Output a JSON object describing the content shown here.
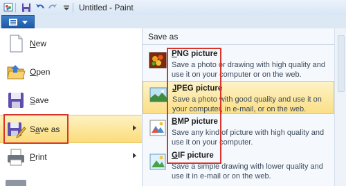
{
  "window": {
    "title": "Untitled - Paint"
  },
  "left_menu": {
    "items": [
      {
        "label": "New",
        "accel": "N",
        "icon": "new-document-icon"
      },
      {
        "label": "Open",
        "accel": "O",
        "icon": "open-folder-icon"
      },
      {
        "label": "Save",
        "accel": "S",
        "icon": "save-disk-icon"
      },
      {
        "label": "Save as",
        "accel": "a",
        "icon": "save-as-icon",
        "selected": true
      },
      {
        "label": "Print",
        "accel": "P",
        "icon": "printer-icon"
      }
    ]
  },
  "submenu": {
    "header": "Save as",
    "items": [
      {
        "title": "PNG picture",
        "desc": "Save a photo or drawing with high quality and use it on your computer or on the web.",
        "icon": "png-picture-icon"
      },
      {
        "title": "JPEG picture",
        "desc": "Save a photo with good quality and use it on your computer, in e-mail, or on the web.",
        "icon": "jpeg-picture-icon",
        "hover": true
      },
      {
        "title": "BMP picture",
        "desc": "Save any kind of picture with high quality and use it on your computer.",
        "icon": "bmp-picture-icon"
      },
      {
        "title": "GIF picture",
        "desc": "Save a simple drawing with lower quality and use it in e-mail or on the web.",
        "icon": "gif-picture-icon"
      }
    ]
  },
  "colors": {
    "highlight": "#fbdc7a",
    "annotation_red": "#d9342b",
    "ribbon_blue": "#1d5aa8"
  }
}
